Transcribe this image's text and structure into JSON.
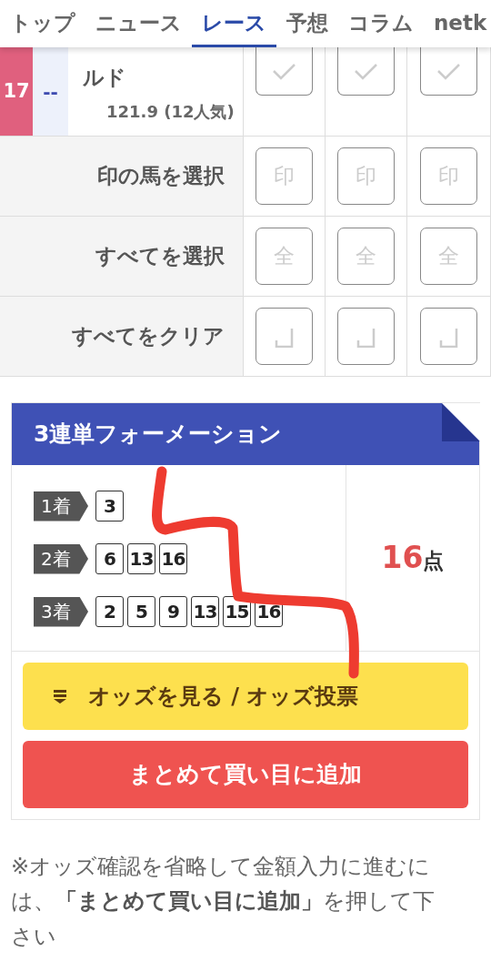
{
  "nav": {
    "tabs": [
      {
        "label": "トップ",
        "selected": false
      },
      {
        "label": "ニュース",
        "selected": false
      },
      {
        "label": "レース",
        "selected": true
      },
      {
        "label": "予想",
        "selected": false
      },
      {
        "label": "コラム",
        "selected": false
      },
      {
        "label": "netk",
        "selected": false
      }
    ]
  },
  "horse_row": {
    "number": "17",
    "mark": "--",
    "name": "ルド",
    "odds": "121.9 (12人気)",
    "checks": [
      {
        "checked": false
      },
      {
        "checked": false
      },
      {
        "checked": false
      }
    ]
  },
  "action_rows": [
    {
      "label": "印の馬を選択",
      "kind": "text",
      "buttons": [
        "印",
        "印",
        "印"
      ]
    },
    {
      "label": "すべてを選択",
      "kind": "text",
      "buttons": [
        "全",
        "全",
        "全"
      ]
    },
    {
      "label": "すべてをクリア",
      "kind": "clear"
    }
  ],
  "formation": {
    "title": "3連単フォーメーション",
    "places": [
      {
        "label": "1着",
        "numbers": [
          "3"
        ]
      },
      {
        "label": "2着",
        "numbers": [
          "6",
          "13",
          "16"
        ]
      },
      {
        "label": "3着",
        "numbers": [
          "2",
          "5",
          "9",
          "13",
          "15",
          "16"
        ]
      }
    ],
    "count": "16",
    "count_unit": "点",
    "odds_button": "オッズを見る / オッズ投票",
    "add_button": "まとめて買い目に追加"
  },
  "note": "※オッズ確認を省略して金額入力に進むには、**「まとめて買い目に追加」**を押して下さい"
}
